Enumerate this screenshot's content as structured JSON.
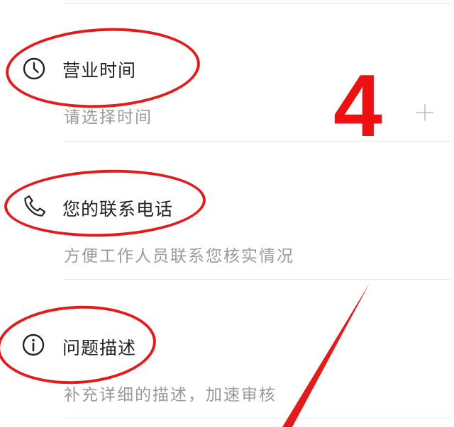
{
  "form": {
    "hours": {
      "icon": "clock-icon",
      "title": "营业时间",
      "placeholder": "请选择时间",
      "add_icon": "plus-icon"
    },
    "phone": {
      "icon": "phone-icon",
      "title": "您的联系电话",
      "placeholder": "方便工作人员联系您核实情况"
    },
    "description": {
      "icon": "info-icon",
      "title": "问题描述",
      "placeholder": "补充详细的描述，加速审核"
    }
  },
  "annotation": {
    "step_number": "4",
    "color": "#e21c1c"
  }
}
